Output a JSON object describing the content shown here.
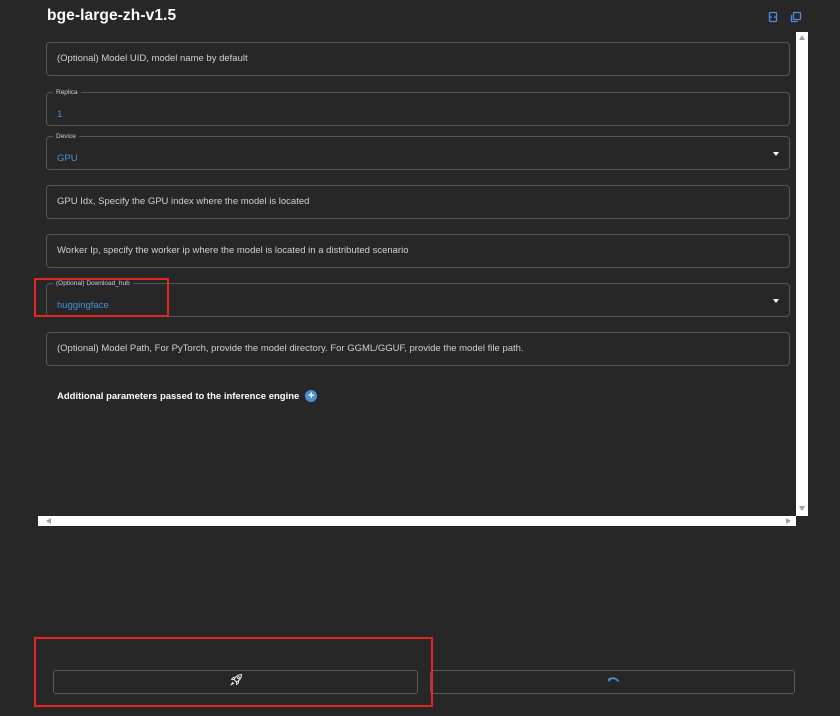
{
  "header": {
    "title": "bge-large-zh-v1.5",
    "icons": [
      "copy-json-icon",
      "copy-icon"
    ],
    "accent": "#4a90d9"
  },
  "form": {
    "model_uid": {
      "placeholder": "(Optional) Model UID, model name by default"
    },
    "replica": {
      "label": "Replica",
      "value": "1"
    },
    "device": {
      "label": "Device",
      "value": "GPU"
    },
    "gpu_idx": {
      "placeholder": "GPU Idx, Specify the GPU index where the model is located"
    },
    "worker_ip": {
      "placeholder": "Worker Ip, specify the worker ip where the model is located in a distributed scenario"
    },
    "download_hub": {
      "label": "(Optional) Download_hub",
      "value": "huggingface"
    },
    "model_path": {
      "placeholder": "(Optional) Model Path, For PyTorch, provide the model directory. For GGML/GGUF, provide the model file path."
    },
    "additional_params": {
      "label": "Additional parameters passed to the inference engine"
    }
  },
  "actions": {
    "launch_icon": "rocket-icon",
    "reset_icon": "undo-icon"
  },
  "colors": {
    "background": "#272727",
    "highlight": "#e0261d",
    "value_text": "#4a90d9"
  }
}
